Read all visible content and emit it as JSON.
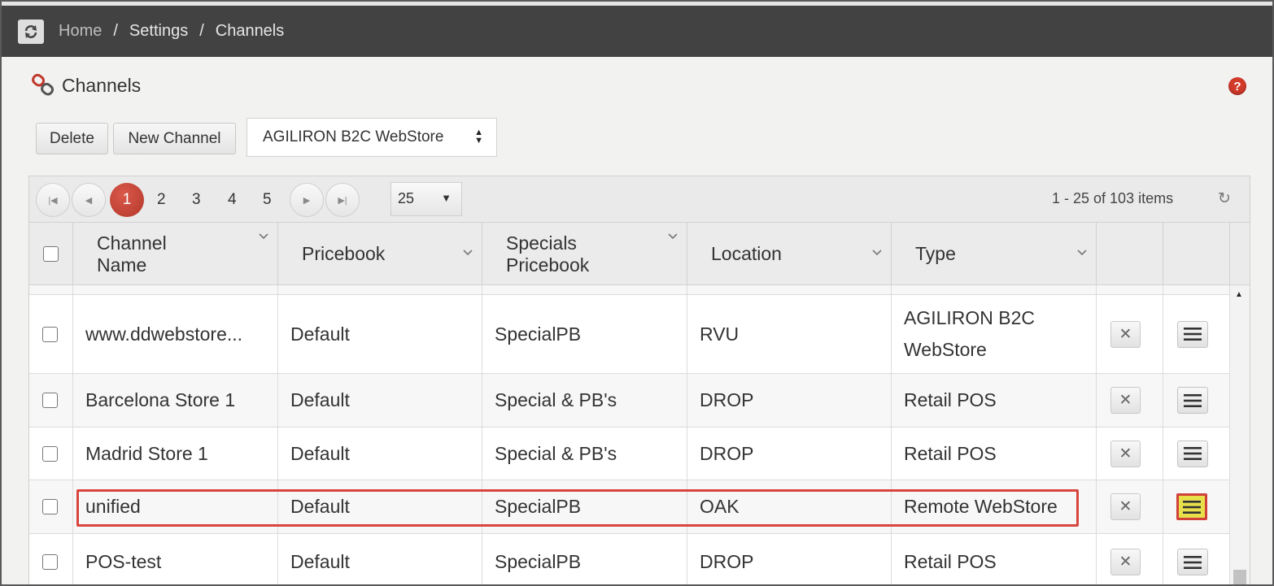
{
  "breadcrumb": {
    "home": "Home",
    "separator": "/",
    "settings": "Settings",
    "current": "Channels"
  },
  "page": {
    "title": "Channels",
    "help": "?"
  },
  "toolbar": {
    "delete_label": "Delete",
    "new_channel_label": "New Channel",
    "channel_filter": "AGILIRON B2C WebStore"
  },
  "pager": {
    "pages": [
      "1",
      "2",
      "3",
      "4",
      "5"
    ],
    "active_page": "1",
    "page_size": "25",
    "info": "1 - 25 of 103 items"
  },
  "columns": {
    "channel_name": "Channel\nName",
    "pricebook": "Pricebook",
    "specials_pricebook": "Specials\nPricebook",
    "location": "Location",
    "type": "Type"
  },
  "rows": [
    {
      "name": "www.ddwebstore...",
      "pricebook": "Default",
      "specials": "SpecialPB",
      "location": "RVU",
      "type": "AGILIRON B2C\nWebStore"
    },
    {
      "name": "Barcelona Store 1",
      "pricebook": "Default",
      "specials": "Special & PB's",
      "location": "DROP",
      "type": "Retail POS"
    },
    {
      "name": "Madrid Store 1",
      "pricebook": "Default",
      "specials": "Special & PB's",
      "location": "DROP",
      "type": "Retail POS"
    },
    {
      "name": "unified",
      "pricebook": "Default",
      "specials": "SpecialPB",
      "location": "OAK",
      "type": "Remote WebStore"
    },
    {
      "name": "POS-test",
      "pricebook": "Default",
      "specials": "SpecialPB",
      "location": "DROP",
      "type": "Retail POS"
    }
  ],
  "icons": {
    "refresh": "refresh-icon",
    "channels": "chain-link-icon",
    "help": "help-icon",
    "delete_row": "close-icon",
    "row_menu": "hamburger-menu-icon"
  },
  "colors": {
    "topbar": "#434242",
    "accent_red": "#c0392b",
    "highlight_yellow": "#e8e04a"
  }
}
